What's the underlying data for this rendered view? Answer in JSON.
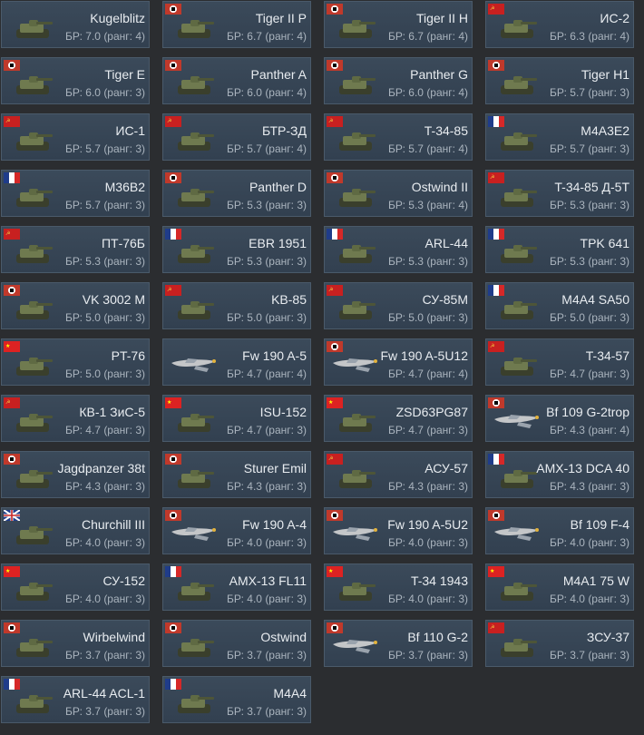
{
  "vehicles": [
    {
      "name": "Kugelblitz",
      "br": "БР: 7.0 (ранг: 4)",
      "flag": "none",
      "kind": "tank"
    },
    {
      "name": "Tiger II P",
      "br": "БР: 6.7 (ранг: 4)",
      "flag": "germany",
      "kind": "tank"
    },
    {
      "name": "Tiger II H",
      "br": "БР: 6.7 (ранг: 4)",
      "flag": "germany",
      "kind": "tank"
    },
    {
      "name": "ИС-2",
      "br": "БР: 6.3 (ранг: 4)",
      "flag": "ussr",
      "kind": "tank"
    },
    {
      "name": "Tiger E",
      "br": "БР: 6.0 (ранг: 3)",
      "flag": "germany",
      "kind": "tank"
    },
    {
      "name": "Panther A",
      "br": "БР: 6.0 (ранг: 4)",
      "flag": "germany",
      "kind": "tank"
    },
    {
      "name": "Panther G",
      "br": "БР: 6.0 (ранг: 4)",
      "flag": "germany",
      "kind": "tank"
    },
    {
      "name": "Tiger H1",
      "br": "БР: 5.7 (ранг: 3)",
      "flag": "germany",
      "kind": "tank"
    },
    {
      "name": "ИС-1",
      "br": "БР: 5.7 (ранг: 3)",
      "flag": "ussr",
      "kind": "tank"
    },
    {
      "name": "БТР-ЗД",
      "br": "БР: 5.7 (ранг: 4)",
      "flag": "ussr",
      "kind": "tank"
    },
    {
      "name": "T-34-85",
      "br": "БР: 5.7 (ранг: 4)",
      "flag": "ussr",
      "kind": "tank"
    },
    {
      "name": "M4A3E2",
      "br": "БР: 5.7 (ранг: 3)",
      "flag": "france",
      "kind": "tank"
    },
    {
      "name": "M36B2",
      "br": "БР: 5.7 (ранг: 3)",
      "flag": "france",
      "kind": "tank"
    },
    {
      "name": "Panther D",
      "br": "БР: 5.3 (ранг: 3)",
      "flag": "germany",
      "kind": "tank"
    },
    {
      "name": "Ostwind II",
      "br": "БР: 5.3 (ранг: 4)",
      "flag": "germany",
      "kind": "tank"
    },
    {
      "name": "T-34-85 Д-5Т",
      "br": "БР: 5.3 (ранг: 3)",
      "flag": "ussr",
      "kind": "tank"
    },
    {
      "name": "ПТ-76Б",
      "br": "БР: 5.3 (ранг: 3)",
      "flag": "ussr",
      "kind": "tank"
    },
    {
      "name": "EBR 1951",
      "br": "БР: 5.3 (ранг: 3)",
      "flag": "france",
      "kind": "tank"
    },
    {
      "name": "ARL-44",
      "br": "БР: 5.3 (ранг: 3)",
      "flag": "france",
      "kind": "tank"
    },
    {
      "name": "TPK 641",
      "br": "БР: 5.3 (ранг: 3)",
      "flag": "france",
      "kind": "tank"
    },
    {
      "name": "VK 3002 M",
      "br": "БР: 5.0 (ранг: 3)",
      "flag": "germany",
      "kind": "tank"
    },
    {
      "name": "KB-85",
      "br": "БР: 5.0 (ранг: 3)",
      "flag": "ussr",
      "kind": "tank"
    },
    {
      "name": "СУ-85М",
      "br": "БР: 5.0 (ранг: 3)",
      "flag": "ussr",
      "kind": "tank"
    },
    {
      "name": "M4A4 SA50",
      "br": "БР: 5.0 (ранг: 3)",
      "flag": "france",
      "kind": "tank"
    },
    {
      "name": "PT-76",
      "br": "БР: 5.0 (ранг: 3)",
      "flag": "china",
      "kind": "tank"
    },
    {
      "name": "Fw 190 A-5",
      "br": "БР: 4.7 (ранг: 4)",
      "flag": "none",
      "kind": "plane"
    },
    {
      "name": "Fw 190 A-5U12",
      "br": "БР: 4.7 (ранг: 4)",
      "flag": "germany",
      "kind": "plane"
    },
    {
      "name": "T-34-57",
      "br": "БР: 4.7 (ранг: 3)",
      "flag": "ussr",
      "kind": "tank"
    },
    {
      "name": "КВ-1 ЗиС-5",
      "br": "БР: 4.7 (ранг: 3)",
      "flag": "ussr",
      "kind": "tank"
    },
    {
      "name": "ISU-152",
      "br": "БР: 4.7 (ранг: 3)",
      "flag": "china",
      "kind": "tank"
    },
    {
      "name": "ZSD63PG87",
      "br": "БР: 4.7 (ранг: 3)",
      "flag": "china",
      "kind": "tank"
    },
    {
      "name": "Bf 109 G-2trop",
      "br": "БР: 4.3 (ранг: 4)",
      "flag": "germany",
      "kind": "plane"
    },
    {
      "name": "Jagdpanzer 38t",
      "br": "БР: 4.3 (ранг: 3)",
      "flag": "germany",
      "kind": "tank"
    },
    {
      "name": "Sturer Emil",
      "br": "БР: 4.3 (ранг: 3)",
      "flag": "germany",
      "kind": "tank"
    },
    {
      "name": "АСУ-57",
      "br": "БР: 4.3 (ранг: 3)",
      "flag": "ussr",
      "kind": "tank"
    },
    {
      "name": "AMX-13 DCA 40",
      "br": "БР: 4.3 (ранг: 3)",
      "flag": "france",
      "kind": "tank"
    },
    {
      "name": "Churchill III",
      "br": "БР: 4.0 (ранг: 3)",
      "flag": "uk",
      "kind": "tank"
    },
    {
      "name": "Fw 190 A-4",
      "br": "БР: 4.0 (ранг: 3)",
      "flag": "germany",
      "kind": "plane"
    },
    {
      "name": "Fw 190 A-5U2",
      "br": "БР: 4.0 (ранг: 3)",
      "flag": "germany",
      "kind": "plane"
    },
    {
      "name": "Bf 109 F-4",
      "br": "БР: 4.0 (ранг: 3)",
      "flag": "germany",
      "kind": "plane"
    },
    {
      "name": "СУ-152",
      "br": "БР: 4.0 (ранг: 3)",
      "flag": "china",
      "kind": "tank"
    },
    {
      "name": "AMX-13 FL11",
      "br": "БР: 4.0 (ранг: 3)",
      "flag": "france",
      "kind": "tank"
    },
    {
      "name": "T-34 1943",
      "br": "БР: 4.0 (ранг: 3)",
      "flag": "china",
      "kind": "tank"
    },
    {
      "name": "M4A1 75 W",
      "br": "БР: 4.0 (ранг: 3)",
      "flag": "china",
      "kind": "tank"
    },
    {
      "name": "Wirbelwind",
      "br": "БР: 3.7 (ранг: 3)",
      "flag": "germany",
      "kind": "tank"
    },
    {
      "name": "Ostwind",
      "br": "БР: 3.7 (ранг: 3)",
      "flag": "germany",
      "kind": "tank"
    },
    {
      "name": "Bf 110 G-2",
      "br": "БР: 3.7 (ранг: 3)",
      "flag": "germany",
      "kind": "plane"
    },
    {
      "name": "ЗСУ-37",
      "br": "БР: 3.7 (ранг: 3)",
      "flag": "ussr",
      "kind": "tank"
    },
    {
      "name": "ARL-44 ACL-1",
      "br": "БР: 3.7 (ранг: 3)",
      "flag": "france",
      "kind": "tank"
    },
    {
      "name": "M4A4",
      "br": "БР: 3.7 (ранг: 3)",
      "flag": "france",
      "kind": "tank"
    }
  ]
}
